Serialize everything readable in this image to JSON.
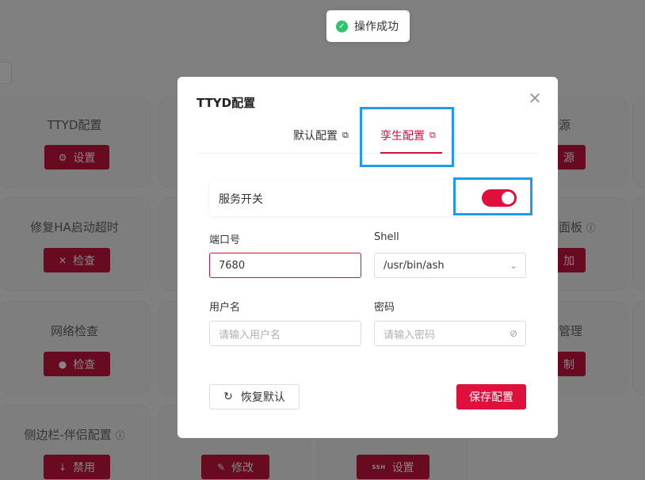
{
  "toast": {
    "text": "操作成功",
    "icon": "check-circle-icon"
  },
  "background_cards": [
    {
      "title": "TTYD配置",
      "button": "设置",
      "button_icon": "gear-icon"
    },
    {
      "title": "修复HA启动超时",
      "button": "检查",
      "button_icon": "tools-icon"
    },
    {
      "title": "网络检查",
      "button": "检查",
      "button_icon": "globe-icon"
    },
    {
      "title": "侧边栏-伴侣配置",
      "button": "禁用",
      "button_icon": "arrow-down-icon"
    },
    {
      "title": "",
      "button": "修改",
      "button_icon": "pencil-icon"
    },
    {
      "title": "",
      "button": "设置",
      "button_icon": "ssh-icon",
      "tag": "SSH"
    },
    {
      "title": "源",
      "button": "源"
    },
    {
      "title": "面板",
      "button": "加"
    },
    {
      "title": "管理",
      "button": "制"
    }
  ],
  "modal": {
    "title": "TTYD配置",
    "tabs": [
      {
        "label": "默认配置"
      },
      {
        "label": "孪生配置"
      }
    ],
    "service_switch": {
      "label": "服务开关",
      "on": true
    },
    "port": {
      "label": "端口号",
      "value": "7680"
    },
    "shell": {
      "label": "Shell",
      "value": "/usr/bin/ash"
    },
    "username": {
      "label": "用户名",
      "placeholder": "请输入用户名"
    },
    "password": {
      "label": "密码",
      "placeholder": "请输入密码"
    },
    "reset_button": "恢复默认",
    "save_button": "保存配置"
  },
  "colors": {
    "accent": "#e0103c",
    "highlight": "#1e9bf0",
    "success": "#2fc36d"
  }
}
